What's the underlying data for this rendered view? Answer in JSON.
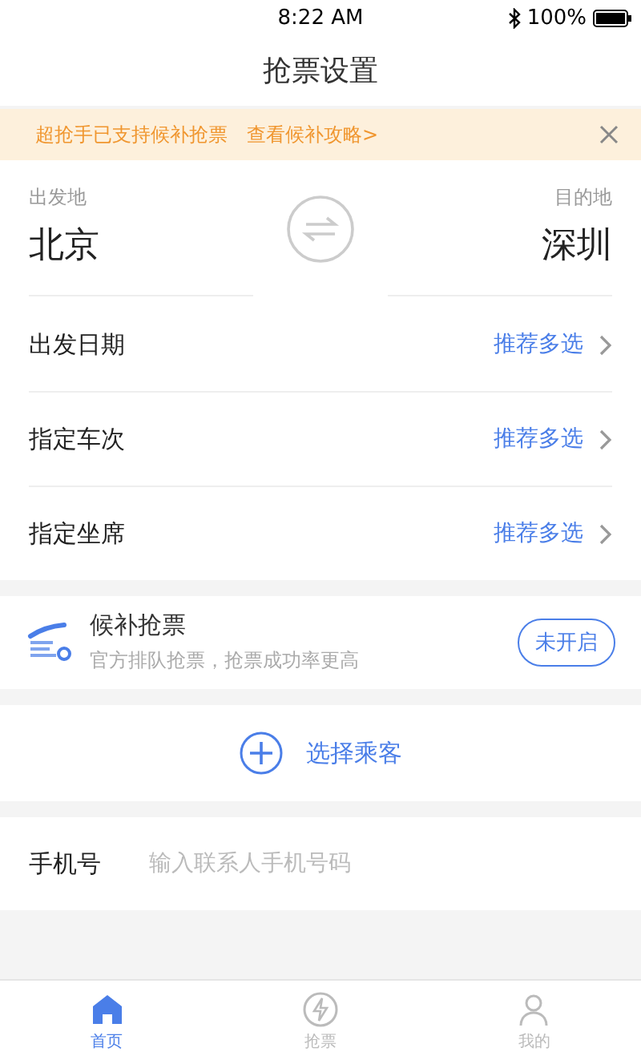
{
  "status_bar": {
    "time": "8:22 AM",
    "battery": "100%"
  },
  "nav": {
    "title": "抢票设置"
  },
  "banner": {
    "text": "超抢手已支持候补抢票",
    "link": "查看候补攻略>"
  },
  "route": {
    "from_label": "出发地",
    "from": "北京",
    "to_label": "目的地",
    "to": "深圳"
  },
  "options": [
    {
      "label": "出发日期",
      "value": "推荐多选"
    },
    {
      "label": "指定车次",
      "value": "推荐多选"
    },
    {
      "label": "指定坐席",
      "value": "推荐多选"
    }
  ],
  "waitlist": {
    "title": "候补抢票",
    "subtitle": "官方排队抢票，抢票成功率更高",
    "button": "未开启"
  },
  "add_passenger": "选择乘客",
  "phone": {
    "label": "手机号",
    "placeholder": "输入联系人手机号码"
  },
  "tabs": [
    {
      "label": "首页",
      "kind": "home",
      "selected": true
    },
    {
      "label": "抢票",
      "kind": "bolt",
      "selected": false
    },
    {
      "label": "我的",
      "kind": "person",
      "selected": false
    }
  ]
}
